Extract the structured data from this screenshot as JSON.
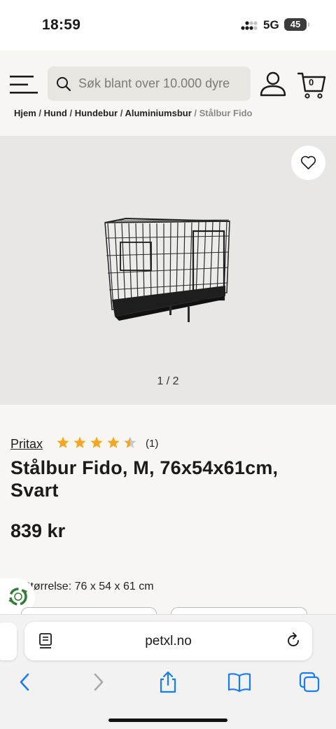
{
  "status_bar": {
    "time": "18:59",
    "network": "5G",
    "battery": "45"
  },
  "header": {
    "search_placeholder": "Søk blant over 10.000 dyre",
    "cart_count": "0",
    "icons": [
      "menu-icon",
      "search-icon",
      "user-icon",
      "cart-icon"
    ]
  },
  "breadcrumb": {
    "items": [
      "Hjem",
      "Hund",
      "Hundebur",
      "Aluminiumsbur"
    ],
    "current": "Stålbur Fido"
  },
  "gallery": {
    "pager": "1 / 2",
    "favorite_icon": "heart-icon"
  },
  "product": {
    "brand": "Pritax",
    "rating": 4.5,
    "rating_max": 5,
    "review_count": "(1)",
    "title": "Stålbur Fido, M, 76x54x61cm, Svart",
    "price": "839 kr",
    "variant_label": "nt Størrelse:",
    "variant_value": "76 x 54 x 61 cm"
  },
  "safari": {
    "url": "petxl.no",
    "icons": [
      "back-icon",
      "forward-icon",
      "share-icon",
      "bookmarks-icon",
      "tabs-icon"
    ]
  },
  "colors": {
    "star": "#f5a623",
    "accent_text": "#1b1b1b",
    "safari_blue": "#1a7cf5"
  }
}
